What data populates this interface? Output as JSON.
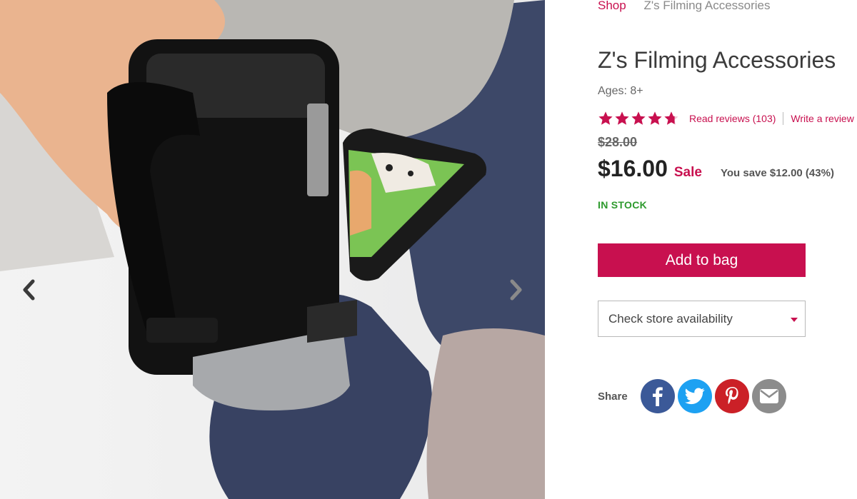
{
  "breadcrumb": {
    "shop": "Shop",
    "current": "Z's Filming Accessories"
  },
  "product": {
    "title": "Z's Filming Accessories",
    "ages": "Ages: 8+",
    "rating": 4.8,
    "reviews_link": "Read reviews (103)",
    "write_review": "Write a review",
    "old_price": "$28.00",
    "price": "$16.00",
    "sale_label": "Sale",
    "savings": "You save $12.00 (43%)",
    "stock": "IN STOCK"
  },
  "actions": {
    "add_to_bag": "Add to bag",
    "store_availability": "Check store availability"
  },
  "share": {
    "label": "Share",
    "networks": [
      "facebook-icon",
      "twitter-icon",
      "pinterest-icon",
      "email-icon"
    ]
  },
  "colors": {
    "brand": "#c8104f",
    "in_stock": "#2d9a2d",
    "facebook": "#3b5998",
    "twitter": "#1da1f2",
    "pinterest": "#cb2027",
    "email": "#8c8c8c"
  }
}
